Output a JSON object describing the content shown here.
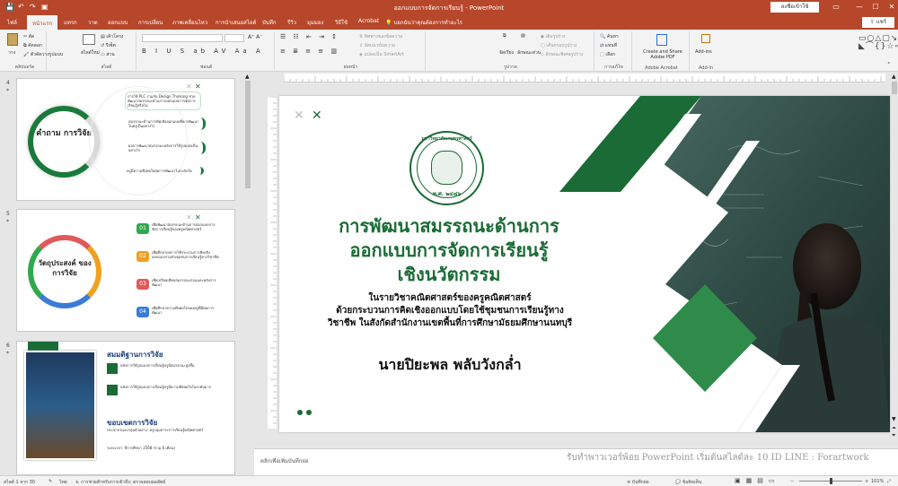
{
  "window": {
    "title": "ออกแบบการจัดการเรียนรู้ - PowerPoint",
    "sign_in": "ลงชื่อเข้าใช้",
    "min": "—",
    "max": "☐",
    "close": "✕"
  },
  "tabs": [
    {
      "label": "ไฟล์",
      "active": false
    },
    {
      "label": "หน้าแรก",
      "active": true
    },
    {
      "label": "แทรก",
      "active": false
    },
    {
      "label": "วาด",
      "active": false
    },
    {
      "label": "ออกแบบ",
      "active": false
    },
    {
      "label": "การเปลี่ยน",
      "active": false
    },
    {
      "label": "ภาพเคลื่อนไหว",
      "active": false
    },
    {
      "label": "การนำเสนอสไลด์",
      "active": false
    },
    {
      "label": "บันทึก",
      "active": false
    },
    {
      "label": "รีวิว",
      "active": false
    },
    {
      "label": "มุมมอง",
      "active": false
    },
    {
      "label": "วิธีใช้",
      "active": false
    },
    {
      "label": "Acrobat",
      "active": false
    }
  ],
  "tell_me": "บอกฉันว่าคุณต้องการทำอะไร",
  "share": "แชร์",
  "ribbon": {
    "clipboard": {
      "paste": "วาง",
      "cut": "ตัด",
      "copy": "คัดลอก",
      "format_painter": "ตัวคัดวางรูปแบบ",
      "name": "คลิปบอร์ด"
    },
    "slides": {
      "new_slide": "สไลด์ใหม่",
      "layout": "เค้าโครง",
      "reset": "รีเซ็ต",
      "section": "ส่วน",
      "name": "สไลด์"
    },
    "font": {
      "name": "ฟอนต์"
    },
    "paragraph": {
      "text_direction": "ทิศทางของข้อความ",
      "align_text": "จัดแนวข้อความ",
      "smartart": "แปลงเป็น SmartArt",
      "name": "ย่อหน้า"
    },
    "drawing": {
      "arrange": "จัดเรียง",
      "quick_styles": "ลักษณะด่วน",
      "fill": "เติมรูปร่าง",
      "outline": "เส้นกรอบรูปร่าง",
      "effects": "ลักษณะพิเศษรูปร่าง",
      "name": "รูปวาด"
    },
    "editing": {
      "find": "ค้นหา",
      "replace": "แทนที่",
      "select": "เลือก",
      "name": "การแก้ไข"
    },
    "adobe": {
      "create": "Create and Share",
      "create2": "Adobe PDF",
      "name": "Adobe Acrobat"
    },
    "addins": {
      "label": "Add-ins",
      "name": "Add-in"
    }
  },
  "thumbnails": {
    "s4": {
      "num": "4",
      "title": "คำถาม การวิจัย",
      "items": [
        "การใช้ PLC ร่วมกับ Design Thinking ช่วยพัฒนาสมรรถนะด้านการออกแบบการจัดการเรียนรู้หรือไม่",
        "สมรรถนะด้านการคิดเชิงออกแบบที่ควรพัฒนาในครูเป็นอย่างไร",
        "ผลการพัฒนาสมรรถนะหลังการใช้รูปแบบเป็นอย่างไร",
        "ครูมีความพึงพอใจต่อการพัฒนาในระดับใด"
      ]
    },
    "s5": {
      "num": "5",
      "title": "วัตถุประสงค์ ของการวิจัย",
      "nums": [
        "01",
        "02",
        "03",
        "04"
      ],
      "items": [
        "เพื่อพัฒนาสมรรถนะด้านการออกแบบการจัดการเรียนรู้ของครูคณิตศาสตร์",
        "เพื่อศึกษาผลการใช้กระบวนการคิดเชิงออกแบบร่วมกับชุมชนการเรียนรู้ทางวิชาชีพ",
        "เพื่อเปรียบเทียบสมรรถนะก่อนและหลังการพัฒนา",
        "เพื่อศึกษาความพึงพอใจของครูที่มีต่อการพัฒนา"
      ]
    },
    "s6": {
      "num": "6",
      "h1": "สมมติฐานการวิจัย",
      "p1": "หลังการใช้รูปแบบการเรียนรู้ครูมีสมรรถนะสูงขึ้น",
      "p2": "หลังการใช้รูปแบบการเรียนรู้ครูมีความพึงพอใจในระดับมาก",
      "h2": "ขอบเขตการวิจัย",
      "p3": "ประชากรและกลุ่มตัวอย่าง: ครูกลุ่มสาระการเรียนรู้คณิตศาสตร์",
      "p4": "ระยะเวลา: ปีการศึกษา 2568 (รวม 6 เดือน)"
    }
  },
  "slide": {
    "title_lines": [
      "การพัฒนาสมรรถนะด้านการ",
      "ออกแบบการจัดการเรียนรู้",
      "เชิงนวัตกรรม"
    ],
    "sub_lines": [
      "ในรายวิชาคณิตศาสตร์ของครูคณิตศาสตร์",
      "ด้วยกระบวนการคิดเชิงออกแบบโดยใช้ชุมชนการเรียนรู้ทาง",
      "วิชาชีพ ในสังกัดสำนักงานเขตพื้นที่การศึกษามัธยมศึกษานนทบุรี"
    ],
    "author": "นายปิยะพล พลับวังกล่ำ",
    "seal_text": "มหาวิทยาลัยเกษตรศาสตร์",
    "seal_year": "พ.ศ. ๒๔๘๖",
    "colors": {
      "green": "#1a6b35",
      "green_light": "#2e8b4a",
      "board": "#2f4a44"
    }
  },
  "notes_placeholder": "คลิกเพื่อเพิ่มบันทึกย่อ",
  "watermark": "รับทำพาวเวอร์พ้อย PowerPoint เริ่มต้นสไลด์ละ 10 ID LINE : Forartwork",
  "status": {
    "slide_of": "สไลด์ 1 จาก 30",
    "lang": "ไทย",
    "access": "การช่วยสำหรับการเข้าถึง: ตรวจสอบผลลัพธ์",
    "notes": "บันทึกย่อ",
    "comments": "ข้อคิดเห็น",
    "zoom": "101%"
  }
}
